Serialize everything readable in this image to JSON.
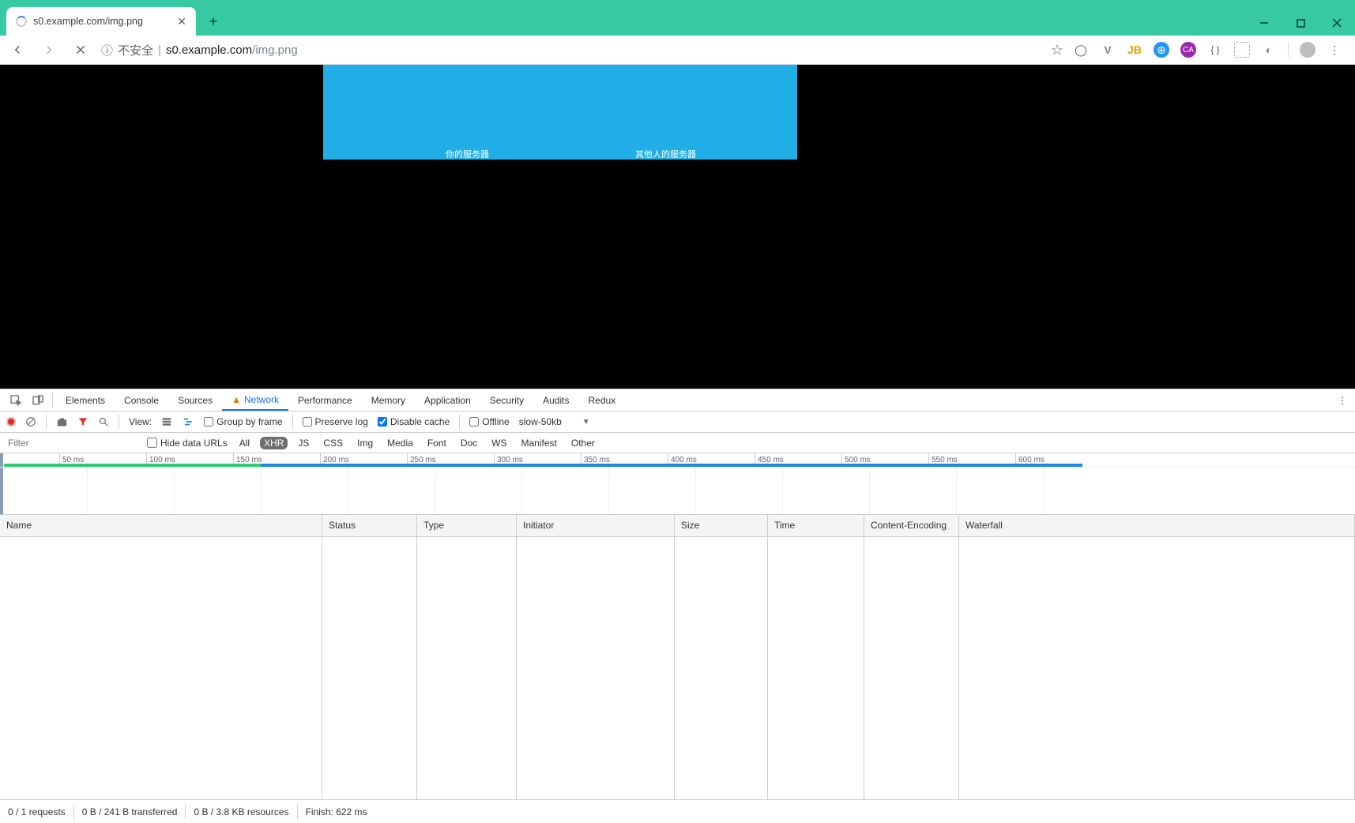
{
  "window": {
    "tab_title": "s0.example.com/img.png"
  },
  "address_bar": {
    "insecure_label": "不安全",
    "host": "s0.example.com",
    "path": "/img.png"
  },
  "page_image": {
    "caption_left": "你的服务器",
    "caption_right": "其他人的服务器"
  },
  "devtools": {
    "tabs": {
      "elements": "Elements",
      "console": "Console",
      "sources": "Sources",
      "network": "Network",
      "performance": "Performance",
      "memory": "Memory",
      "application": "Application",
      "security": "Security",
      "audits": "Audits",
      "redux": "Redux"
    },
    "bar1": {
      "view_label": "View:",
      "group_by_frame": "Group by frame",
      "preserve_log": "Preserve log",
      "disable_cache": "Disable cache",
      "offline": "Offline",
      "throttle": "slow-50kb"
    },
    "bar2": {
      "filter_placeholder": "Filter",
      "hide_data_urls": "Hide data URLs",
      "chips": {
        "all": "All",
        "xhr": "XHR",
        "js": "JS",
        "css": "CSS",
        "img": "Img",
        "media": "Media",
        "font": "Font",
        "doc": "Doc",
        "ws": "WS",
        "manifest": "Manifest",
        "other": "Other"
      }
    },
    "timeline_ticks": [
      "50 ms",
      "100 ms",
      "150 ms",
      "200 ms",
      "250 ms",
      "300 ms",
      "350 ms",
      "400 ms",
      "450 ms",
      "500 ms",
      "550 ms",
      "600 ms"
    ],
    "columns": {
      "name": "Name",
      "status": "Status",
      "type": "Type",
      "initiator": "Initiator",
      "size": "Size",
      "time": "Time",
      "content_encoding": "Content-Encoding",
      "waterfall": "Waterfall"
    },
    "status": {
      "requests": "0 / 1 requests",
      "transferred": "0 B / 241 B transferred",
      "resources": "0 B / 3.8 KB resources",
      "finish": "Finish: 622 ms"
    }
  }
}
